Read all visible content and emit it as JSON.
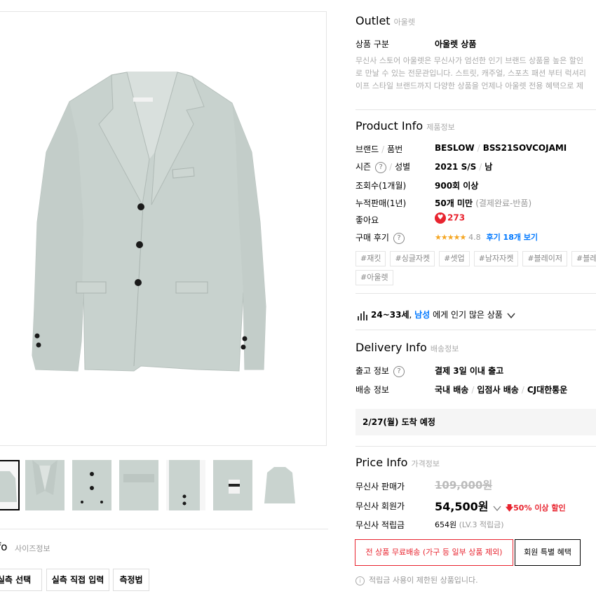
{
  "outlet": {
    "title": "Outlet",
    "subtitle": "아울렛",
    "category_label": "상품 구분",
    "category_value": "아울렛 상품",
    "description_lines": [
      "무신사 스토어 아울렛은 무신사가 엄선한 인기 브랜드 상품을 높은 할인",
      "로 만날 수 있는 전문관입니다. 스트릿, 캐주얼, 스포츠 패션 부터 럭셔리",
      "이프 스타일 브랜드까지 다양한 상품을 언제나 아울렛 전용 혜택으로 제"
    ]
  },
  "product_info": {
    "title": "Product Info",
    "subtitle": "제품정보",
    "brand_label": "브랜드",
    "code_label": "품번",
    "brand": "BESLOW",
    "code": "BSS21SOVCOJAMI",
    "season_label": "시즌",
    "gender_label": "성별",
    "season": "2021 S/S",
    "gender": "남",
    "views_label": "조회수(1개월)",
    "views": "900회 이상",
    "sales_label": "누적판매(1년)",
    "sales": "50개 미만",
    "sales_note": "(결제완료-반품)",
    "likes_label": "좋아요",
    "likes": "273",
    "review_label": "구매 후기",
    "stars": "★★★★★",
    "rating": "4.8",
    "review_link": "후기 18개 보기",
    "tags_row1": [
      "#재킷",
      "#싱글자켓",
      "#셋업",
      "#남자자켓",
      "#블레이저",
      "#블레이저"
    ],
    "tags_row2": [
      "#아울렛"
    ]
  },
  "popular": {
    "age": "24~33세",
    "gender": "남성",
    "text": "에게 인기 많은 상품"
  },
  "delivery_info": {
    "title": "Delivery Info",
    "subtitle": "배송정보",
    "ship_label": "출고 정보",
    "ship_value": "결제 3일 이내 출고",
    "method_label": "배송 정보",
    "method1": "국내 배송",
    "method2": "입점사 배송",
    "method3": "CJ대한통운",
    "arrival": "2/27(월) 도착 예정"
  },
  "price_info": {
    "title": "Price Info",
    "subtitle": "가격정보",
    "sale_price_label": "무신사 판매가",
    "sale_price": "109,000원",
    "member_price_label": "무신사 회원가",
    "member_price": "54,500원",
    "discount": "50% 이상 할인",
    "points_label": "무신사 적립금",
    "points": "654원",
    "points_note": "(LV.3 적립금)",
    "free_shipping_button": "전 상품 무료배송 (가구 등 일부 상품 제외)",
    "member_benefit_button": "회원 특별 혜택",
    "notice": "적립금 사용이 제한된 상품입니다."
  },
  "size_info": {
    "title": "fo",
    "subtitle": "사이즈정보",
    "buttons": [
      "실측 선택",
      "실측 직접 입력",
      "측정법"
    ]
  },
  "icons": {
    "help": "question-circle-icon",
    "heart": "heart-icon",
    "chart": "bar-chart-icon",
    "chevron": "chevron-down-icon",
    "down_arrow": "arrow-down-icon",
    "info": "info-circle-icon"
  },
  "colors": {
    "accent_red": "#e8242f",
    "link_blue": "#0078ff",
    "jacket": "#c9d3cf"
  }
}
